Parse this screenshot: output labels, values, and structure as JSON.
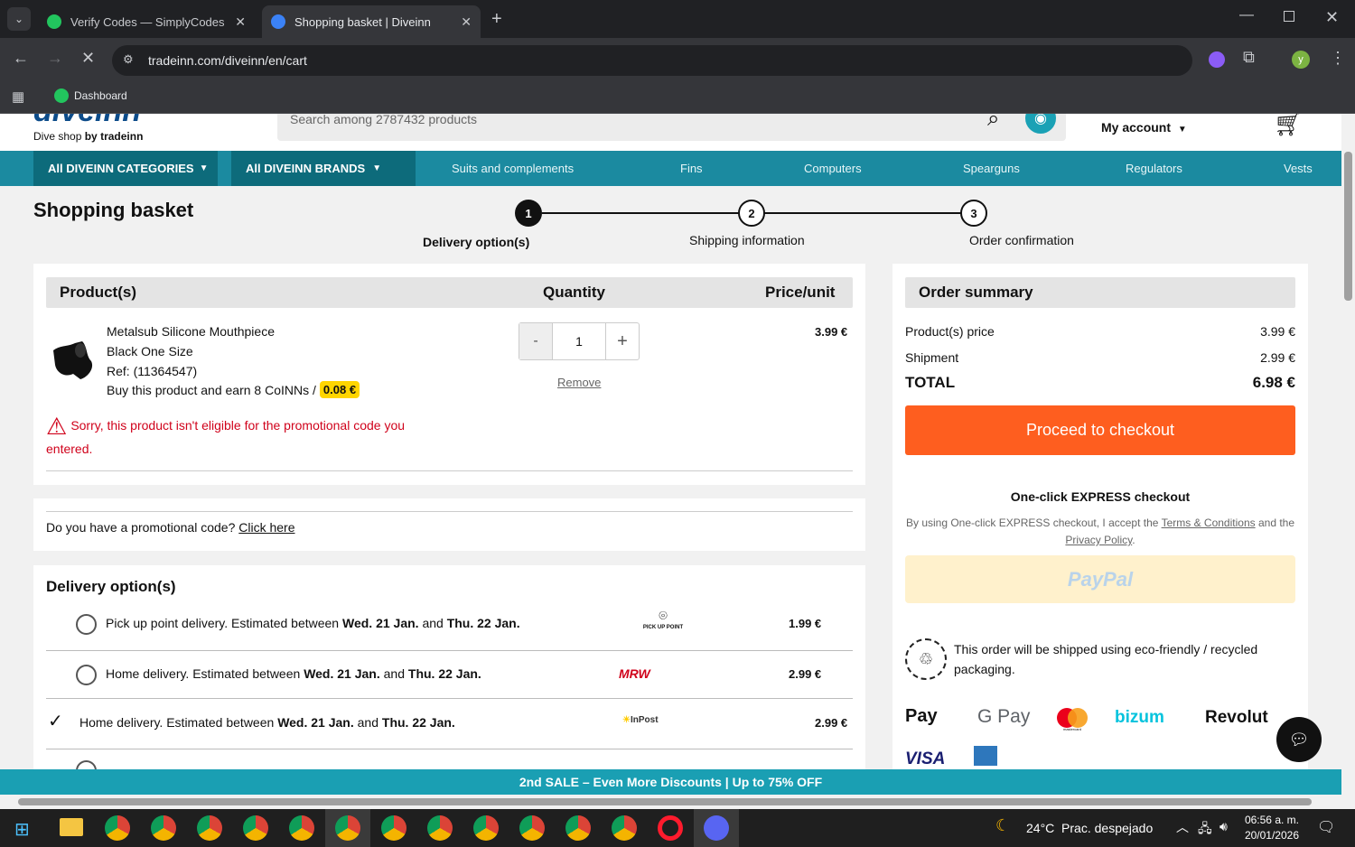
{
  "browser": {
    "tabs": [
      {
        "title": "Verify Codes — SimplyCodes",
        "active": false,
        "favicon_color": "#22c55e"
      },
      {
        "title": "Shopping basket | Diveinn",
        "active": true,
        "favicon_color": "#3b82f6"
      }
    ],
    "url": "tradeinn.com/diveinn/en/cart",
    "bookmark": "Dashboard",
    "profile_initial": "y"
  },
  "site": {
    "logo_text": "diveinn",
    "tagline_prefix": "Dive shop",
    "tagline_by": "by",
    "tagline_brand": "tradeinn",
    "search_placeholder": "Search among 2787432 products",
    "account_label": "My account",
    "nav": {
      "categories_label": "All DIVEINN CATEGORIES",
      "brands_label": "All DIVEINN BRANDS",
      "items": [
        "Suits and complements",
        "Fins",
        "Computers",
        "Spearguns",
        "Regulators",
        "Vests"
      ]
    }
  },
  "cart": {
    "title": "Shopping basket",
    "steps": [
      {
        "number": "1",
        "label": "Delivery option(s)"
      },
      {
        "number": "2",
        "label": "Shipping information"
      },
      {
        "number": "3",
        "label": "Order confirmation"
      }
    ],
    "table_headers": {
      "product": "Product(s)",
      "quantity": "Quantity",
      "price": "Price/unit"
    },
    "item": {
      "name": "Metalsub Silicone Mouthpiece",
      "variant": "Black One Size",
      "ref": "Ref: (11364547)",
      "coins_text": "Buy this product and earn 8 CoINNs /",
      "coins_value": "0.08 €",
      "quantity": "1",
      "minus": "-",
      "plus": "+",
      "remove_label": "Remove",
      "price": "3.99 €",
      "warning": "Sorry, this product isn't eligible for the promotional code you entered."
    },
    "promo": {
      "question": "Do you have a promotional code?",
      "link": "Click here"
    },
    "delivery": {
      "title": "Delivery option(s)",
      "options": [
        {
          "text_prefix": "Pick up point delivery. Estimated between",
          "date1": "Wed. 21 Jan.",
          "and": "and",
          "date2": "Thu. 22 Jan.",
          "carrier": "PICK UP POINT",
          "price": "1.99 €",
          "selected": false
        },
        {
          "text_prefix": "Home delivery. Estimated between",
          "date1": "Wed. 21 Jan.",
          "and": "and",
          "date2": "Thu. 22 Jan.",
          "carrier": "MRW",
          "price": "2.99 €",
          "selected": false
        },
        {
          "text_prefix": "Home delivery. Estimated between",
          "date1": "Wed. 21 Jan.",
          "and": "and",
          "date2": "Thu. 22 Jan.",
          "carrier": "InPost",
          "price": "2.99 €",
          "selected": true
        }
      ]
    }
  },
  "summary": {
    "title": "Order summary",
    "products_label": "Product(s) price",
    "products_value": "3.99 €",
    "shipment_label": "Shipment",
    "shipment_value": "2.99 €",
    "total_label": "TOTAL",
    "total_value": "6.98 €",
    "checkout_button": "Proceed to checkout",
    "express_title_prefix": "One-click",
    "express_title_bold": "EXPRESS",
    "express_title_suffix": "checkout",
    "express_terms_prefix": "By using One-click EXPRESS checkout, I accept the",
    "terms_link": "Terms & Conditions",
    "and_the": "and the",
    "privacy_link": "Privacy Policy",
    "paypal_label": "PayPal",
    "eco_text": "This order will be shipped using eco-friendly / recycled packaging.",
    "payment_methods": [
      "Pay",
      "G Pay",
      "mastercard",
      "bizum",
      "Revolut",
      "VISA"
    ]
  },
  "promo_bar": "2nd SALE – Even More Discounts | Up to 75% OFF",
  "taskbar": {
    "weather": "24°C  Prac. despejado",
    "time": "06:56 a. m.",
    "date": "20/01/2026"
  },
  "colors": {
    "accent": "#1b8aa0",
    "checkout": "#fe5e1f",
    "warning": "#d0021b",
    "coins_badge": "#ffd500"
  }
}
